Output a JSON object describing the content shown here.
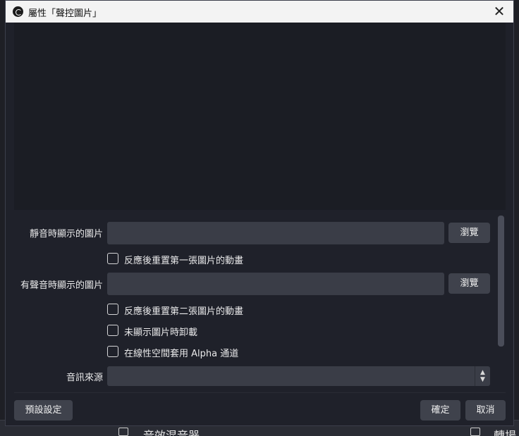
{
  "window": {
    "title": "屬性「聲控圖片」"
  },
  "form": {
    "muted_image_label": "靜音時顯示的圖片",
    "muted_image_value": "",
    "muted_browse": "瀏覽",
    "reset_first_label": "反應後重置第一張圖片的動畫",
    "reset_first_checked": false,
    "sound_image_label": "有聲音時顯示的圖片",
    "sound_image_value": "",
    "sound_browse": "瀏覽",
    "reset_second_label": "反應後重置第二張圖片的動畫",
    "reset_second_checked": false,
    "unload_label": "未顯示圖片時卸載",
    "unload_checked": false,
    "linear_alpha_label": "在線性空間套用 Alpha 通道",
    "linear_alpha_checked": false,
    "audio_source_label": "音訊來源",
    "audio_source_value": ""
  },
  "footer": {
    "defaults_label": "預設設定",
    "ok_label": "確定",
    "cancel_label": "取消"
  },
  "background_app": {
    "mixer_label": "音效混音器",
    "right_label": "轉場"
  },
  "icons": {
    "close": "close-icon",
    "app": "obs-icon",
    "spinner": "up-down-chevron-icon"
  }
}
